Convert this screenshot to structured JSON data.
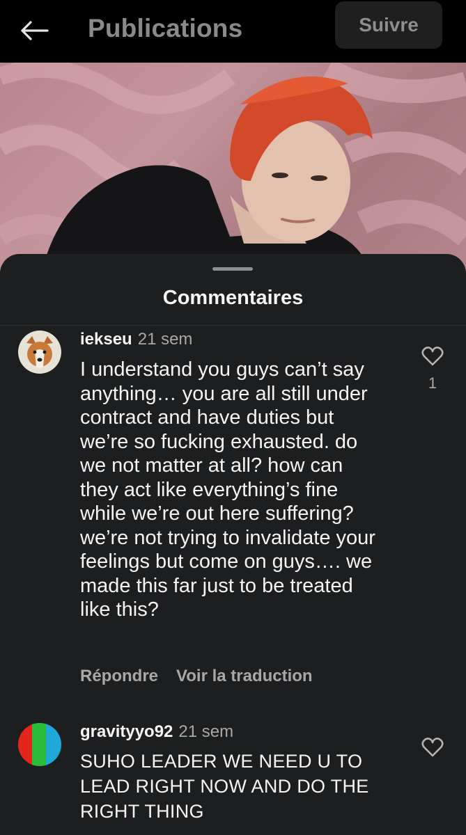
{
  "header": {
    "back_icon": "arrow-left-icon",
    "title": "Publications",
    "follow_label": "Suivre"
  },
  "sheet": {
    "title": "Commentaires"
  },
  "comments": [
    {
      "username": "iekseu",
      "time": "21 sem",
      "text": "I understand you guys can’t say anything… you are all still under contract and have duties but we’re so fucking exhausted. do we not matter at all? how can they act like everything’s fine while we’re out here suffering? we’re not trying to invalidate your feelings but come on guys…. we made this far just to be treated like this?",
      "likes": "1",
      "reply_label": "Répondre",
      "translate_label": "Voir la traduction"
    },
    {
      "username": "gravityyo92",
      "time": "21 sem",
      "text": "SUHO LEADER WE NEED U TO LEAD RIGHT NOW AND DO THE RIGHT THING"
    }
  ],
  "icons": {
    "like": "heart-outline-icon"
  },
  "colors": {
    "background": "#000000",
    "sheet": "#1c1e20",
    "secondary_text": "#a8a8a8"
  }
}
